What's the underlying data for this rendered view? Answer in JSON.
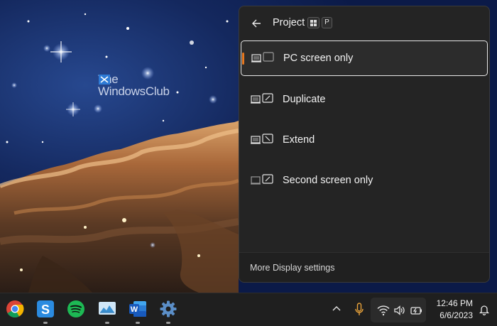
{
  "watermark": {
    "line1": "The",
    "line2": "WindowsClub"
  },
  "flyout": {
    "title": "Project",
    "shortcut_keys": [
      "win-key",
      "P"
    ],
    "options": [
      {
        "label": "PC screen only",
        "icon": "pc-screen-only-icon",
        "selected": true
      },
      {
        "label": "Duplicate",
        "icon": "duplicate-icon",
        "selected": false
      },
      {
        "label": "Extend",
        "icon": "extend-icon",
        "selected": false
      },
      {
        "label": "Second screen only",
        "icon": "second-screen-only-icon",
        "selected": false
      }
    ],
    "footer_link": "More Display settings"
  },
  "taskbar": {
    "apps": [
      "chrome-icon",
      "snagit-icon",
      "spotify-icon",
      "photos-icon",
      "word-icon",
      "settings-icon"
    ],
    "tray_icons": [
      "chevron-up-icon",
      "microphone-icon",
      "wifi-icon",
      "volume-icon",
      "battery-icon",
      "bell-icon"
    ],
    "time": "12:46 PM",
    "date": "6/6/2023"
  },
  "colors": {
    "accent": "#e8781f",
    "flyout_bg": "#242424",
    "taskbar_bg": "#1f1f1f"
  }
}
